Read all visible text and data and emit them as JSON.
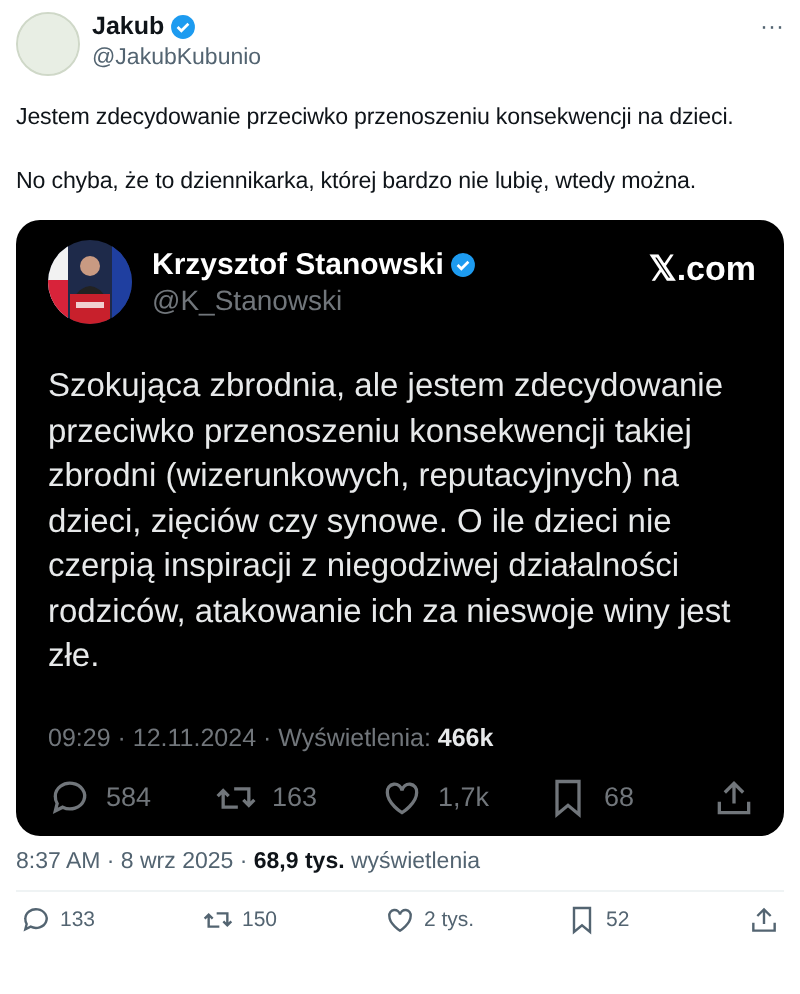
{
  "author": {
    "name": "Jakub",
    "verified": true,
    "handle": "@JakubKubunio"
  },
  "more": "···",
  "paragraphs": [
    "Jestem zdecydowanie przeciwko przenoszeniu konsekwencji na dzieci.",
    "No chyba, że to dziennikarka, której bardzo nie lubię, wtedy można."
  ],
  "quote": {
    "author": {
      "name": "Krzysztof Stanowski",
      "verified": true,
      "handle": "@K_Stanowski"
    },
    "site": "𝕏.com",
    "text": "Szokująca zbrodnia, ale jestem zdecydowanie przeciwko przenoszeniu konsekwencji takiej zbrodni (wizerunkowych, reputacyjnych) na dzieci, zięciów czy synowe. O ile dzieci nie czerpią inspiracji z niegodziwej działalności rodziców, atakowanie ich za nieswoje winy jest złe.",
    "meta": "09:29 · 12.11.2024 · Wyświetlenia: **466k**",
    "actions": [
      {
        "kind": "reply",
        "count": "584"
      },
      {
        "kind": "repost",
        "count": "163"
      },
      {
        "kind": "like",
        "count": "1,7k"
      },
      {
        "kind": "bookmark",
        "count": "68"
      },
      {
        "kind": "share"
      }
    ]
  },
  "meta": "8:37 AM · 8 wrz 2025 · **68,9 tys.** wyświetlenia",
  "actions": [
    {
      "kind": "reply",
      "count": "133"
    },
    {
      "kind": "repost",
      "count": "150"
    },
    {
      "kind": "like",
      "count": "2 tys."
    },
    {
      "kind": "bookmark",
      "count": "52"
    },
    {
      "kind": "share"
    }
  ]
}
